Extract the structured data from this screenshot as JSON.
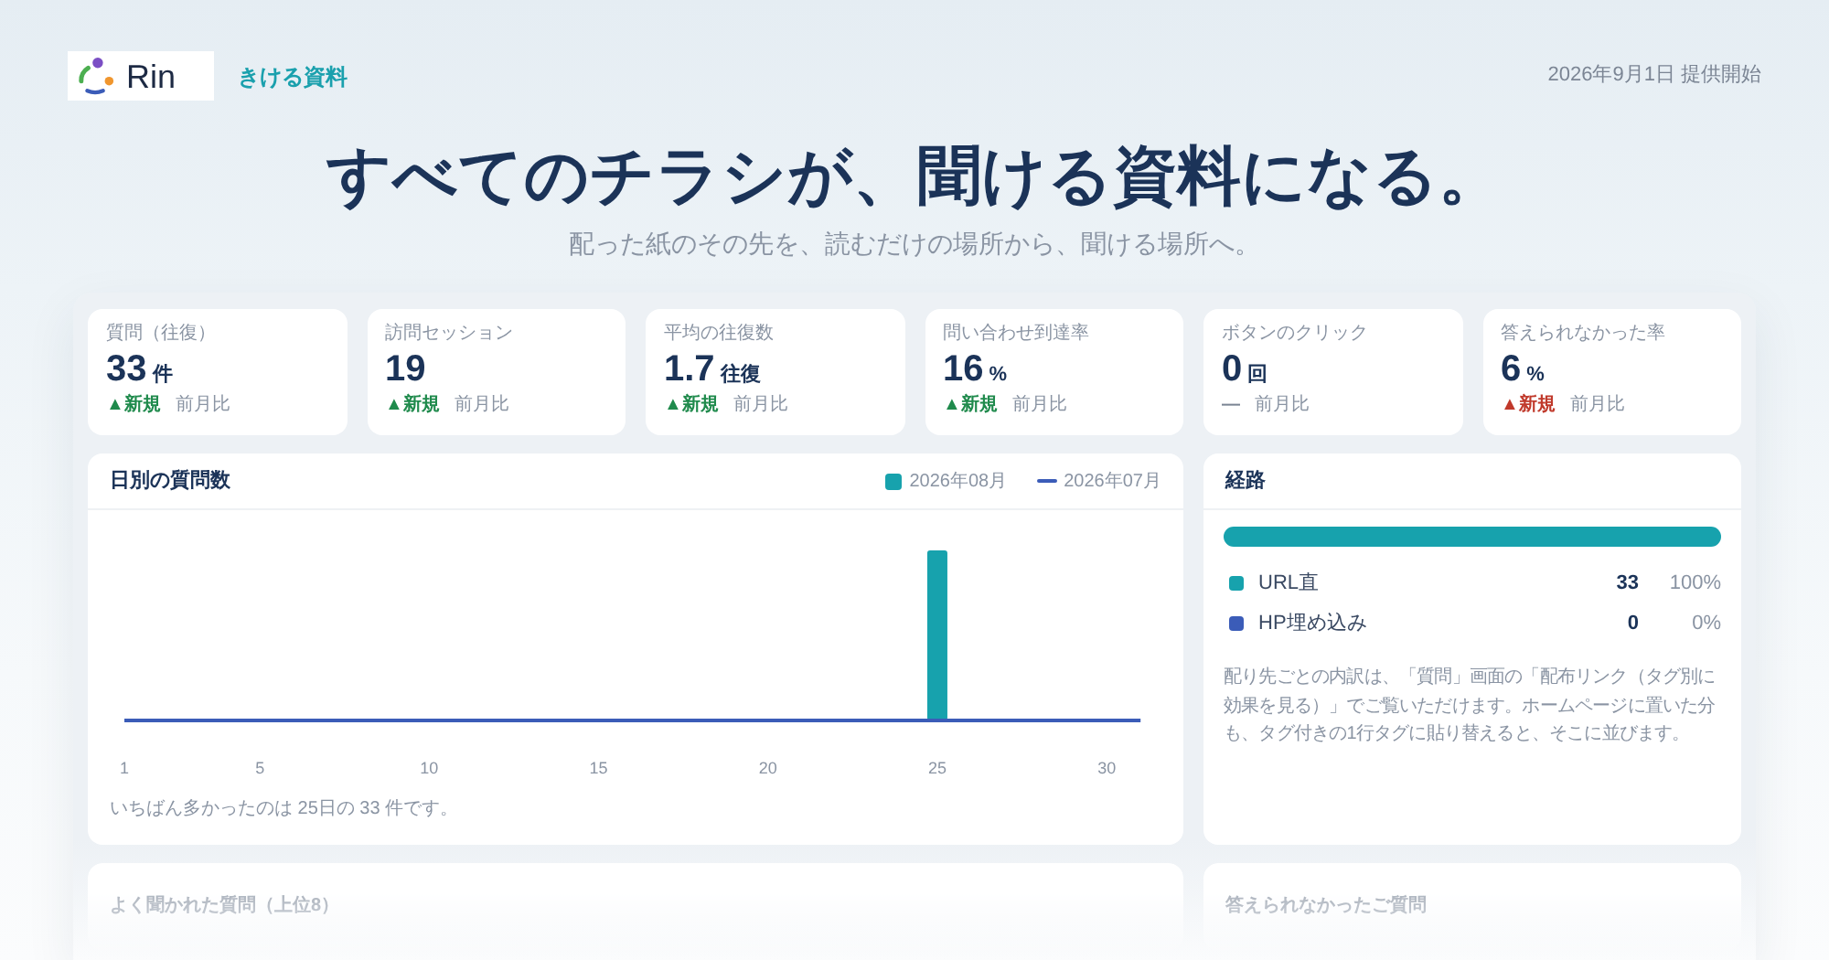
{
  "header": {
    "brand": "Rin",
    "product": "きける資料",
    "launch": "2026年9月1日 提供開始"
  },
  "hero": {
    "title": "すべてのチラシが、聞ける資料になる。",
    "subtitle": "配った紙のその先を、読むだけの場所から、聞ける場所へ。"
  },
  "stats": [
    {
      "label": "質問（往復）",
      "value": "33",
      "unit": "件",
      "delta": "▲新規",
      "color": "#1f8a4c",
      "compare": "前月比"
    },
    {
      "label": "訪問セッション",
      "value": "19",
      "delta": "▲新規",
      "color": "#1f8a4c",
      "compare": "前月比"
    },
    {
      "label": "平均の往復数",
      "value": "1.7",
      "unit": "往復",
      "delta": "▲新規",
      "color": "#1f8a4c",
      "compare": "前月比"
    },
    {
      "label": "問い合わせ到達率",
      "value": "16",
      "unit": "%",
      "delta": "▲新規",
      "color": "#1f8a4c",
      "compare": "前月比"
    },
    {
      "label": "ボタンのクリック",
      "value": "0",
      "unit": "回",
      "delta": "—",
      "color": "#7b8594",
      "compare": "前月比"
    },
    {
      "label": "答えられなかった率",
      "value": "6",
      "unit": "%",
      "delta": "▲新規",
      "color": "#c0392b",
      "compare": "前月比"
    }
  ],
  "daily_chart": {
    "title": "日別の質問数",
    "legend": [
      {
        "name": "2026年08月",
        "kind": "bar",
        "color": "#17a2ad"
      },
      {
        "name": "2026年07月",
        "kind": "line",
        "color": "#3b5cb8"
      }
    ],
    "x_labels": [
      "1",
      "5",
      "10",
      "15",
      "20",
      "25",
      "30"
    ],
    "summary": "いちばん多かったのは 25日の 33 件です。"
  },
  "routes": {
    "title": "経路",
    "sources": [
      {
        "name": "URL直",
        "count": "33",
        "percent": "100%",
        "level": 1,
        "color": "#17a2ad"
      },
      {
        "name": "HP埋め込み",
        "count": "0",
        "percent": "0%",
        "level": 0,
        "color": "#3b5cb8"
      }
    ],
    "note": "配り先ごとの内訳は、「質問」画面の「配布リンク（タグ別に効果を見る）」でご覧いただけます。ホームページに置いた分も、タグ付きの1行タグに貼り替えると、そこに並びます。"
  },
  "lower_panels": [
    {
      "title": "よく聞かれた質問（上位8）"
    },
    {
      "title": "答えられなかったご質問"
    }
  ]
}
